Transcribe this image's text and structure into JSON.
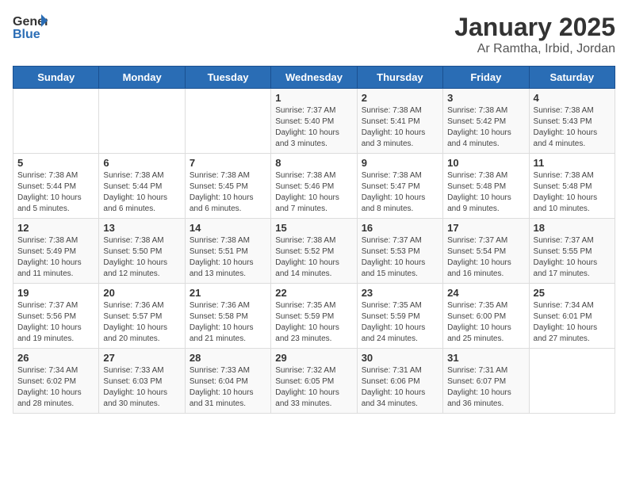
{
  "header": {
    "logo_general": "General",
    "logo_blue": "Blue",
    "month": "January 2025",
    "location": "Ar Ramtha, Irbid, Jordan"
  },
  "weekdays": [
    "Sunday",
    "Monday",
    "Tuesday",
    "Wednesday",
    "Thursday",
    "Friday",
    "Saturday"
  ],
  "weeks": [
    [
      {
        "day": "",
        "sunrise": "",
        "sunset": "",
        "daylight": ""
      },
      {
        "day": "",
        "sunrise": "",
        "sunset": "",
        "daylight": ""
      },
      {
        "day": "",
        "sunrise": "",
        "sunset": "",
        "daylight": ""
      },
      {
        "day": "1",
        "sunrise": "Sunrise: 7:37 AM",
        "sunset": "Sunset: 5:40 PM",
        "daylight": "Daylight: 10 hours and 3 minutes."
      },
      {
        "day": "2",
        "sunrise": "Sunrise: 7:38 AM",
        "sunset": "Sunset: 5:41 PM",
        "daylight": "Daylight: 10 hours and 3 minutes."
      },
      {
        "day": "3",
        "sunrise": "Sunrise: 7:38 AM",
        "sunset": "Sunset: 5:42 PM",
        "daylight": "Daylight: 10 hours and 4 minutes."
      },
      {
        "day": "4",
        "sunrise": "Sunrise: 7:38 AM",
        "sunset": "Sunset: 5:43 PM",
        "daylight": "Daylight: 10 hours and 4 minutes."
      }
    ],
    [
      {
        "day": "5",
        "sunrise": "Sunrise: 7:38 AM",
        "sunset": "Sunset: 5:44 PM",
        "daylight": "Daylight: 10 hours and 5 minutes."
      },
      {
        "day": "6",
        "sunrise": "Sunrise: 7:38 AM",
        "sunset": "Sunset: 5:44 PM",
        "daylight": "Daylight: 10 hours and 6 minutes."
      },
      {
        "day": "7",
        "sunrise": "Sunrise: 7:38 AM",
        "sunset": "Sunset: 5:45 PM",
        "daylight": "Daylight: 10 hours and 6 minutes."
      },
      {
        "day": "8",
        "sunrise": "Sunrise: 7:38 AM",
        "sunset": "Sunset: 5:46 PM",
        "daylight": "Daylight: 10 hours and 7 minutes."
      },
      {
        "day": "9",
        "sunrise": "Sunrise: 7:38 AM",
        "sunset": "Sunset: 5:47 PM",
        "daylight": "Daylight: 10 hours and 8 minutes."
      },
      {
        "day": "10",
        "sunrise": "Sunrise: 7:38 AM",
        "sunset": "Sunset: 5:48 PM",
        "daylight": "Daylight: 10 hours and 9 minutes."
      },
      {
        "day": "11",
        "sunrise": "Sunrise: 7:38 AM",
        "sunset": "Sunset: 5:48 PM",
        "daylight": "Daylight: 10 hours and 10 minutes."
      }
    ],
    [
      {
        "day": "12",
        "sunrise": "Sunrise: 7:38 AM",
        "sunset": "Sunset: 5:49 PM",
        "daylight": "Daylight: 10 hours and 11 minutes."
      },
      {
        "day": "13",
        "sunrise": "Sunrise: 7:38 AM",
        "sunset": "Sunset: 5:50 PM",
        "daylight": "Daylight: 10 hours and 12 minutes."
      },
      {
        "day": "14",
        "sunrise": "Sunrise: 7:38 AM",
        "sunset": "Sunset: 5:51 PM",
        "daylight": "Daylight: 10 hours and 13 minutes."
      },
      {
        "day": "15",
        "sunrise": "Sunrise: 7:38 AM",
        "sunset": "Sunset: 5:52 PM",
        "daylight": "Daylight: 10 hours and 14 minutes."
      },
      {
        "day": "16",
        "sunrise": "Sunrise: 7:37 AM",
        "sunset": "Sunset: 5:53 PM",
        "daylight": "Daylight: 10 hours and 15 minutes."
      },
      {
        "day": "17",
        "sunrise": "Sunrise: 7:37 AM",
        "sunset": "Sunset: 5:54 PM",
        "daylight": "Daylight: 10 hours and 16 minutes."
      },
      {
        "day": "18",
        "sunrise": "Sunrise: 7:37 AM",
        "sunset": "Sunset: 5:55 PM",
        "daylight": "Daylight: 10 hours and 17 minutes."
      }
    ],
    [
      {
        "day": "19",
        "sunrise": "Sunrise: 7:37 AM",
        "sunset": "Sunset: 5:56 PM",
        "daylight": "Daylight: 10 hours and 19 minutes."
      },
      {
        "day": "20",
        "sunrise": "Sunrise: 7:36 AM",
        "sunset": "Sunset: 5:57 PM",
        "daylight": "Daylight: 10 hours and 20 minutes."
      },
      {
        "day": "21",
        "sunrise": "Sunrise: 7:36 AM",
        "sunset": "Sunset: 5:58 PM",
        "daylight": "Daylight: 10 hours and 21 minutes."
      },
      {
        "day": "22",
        "sunrise": "Sunrise: 7:35 AM",
        "sunset": "Sunset: 5:59 PM",
        "daylight": "Daylight: 10 hours and 23 minutes."
      },
      {
        "day": "23",
        "sunrise": "Sunrise: 7:35 AM",
        "sunset": "Sunset: 5:59 PM",
        "daylight": "Daylight: 10 hours and 24 minutes."
      },
      {
        "day": "24",
        "sunrise": "Sunrise: 7:35 AM",
        "sunset": "Sunset: 6:00 PM",
        "daylight": "Daylight: 10 hours and 25 minutes."
      },
      {
        "day": "25",
        "sunrise": "Sunrise: 7:34 AM",
        "sunset": "Sunset: 6:01 PM",
        "daylight": "Daylight: 10 hours and 27 minutes."
      }
    ],
    [
      {
        "day": "26",
        "sunrise": "Sunrise: 7:34 AM",
        "sunset": "Sunset: 6:02 PM",
        "daylight": "Daylight: 10 hours and 28 minutes."
      },
      {
        "day": "27",
        "sunrise": "Sunrise: 7:33 AM",
        "sunset": "Sunset: 6:03 PM",
        "daylight": "Daylight: 10 hours and 30 minutes."
      },
      {
        "day": "28",
        "sunrise": "Sunrise: 7:33 AM",
        "sunset": "Sunset: 6:04 PM",
        "daylight": "Daylight: 10 hours and 31 minutes."
      },
      {
        "day": "29",
        "sunrise": "Sunrise: 7:32 AM",
        "sunset": "Sunset: 6:05 PM",
        "daylight": "Daylight: 10 hours and 33 minutes."
      },
      {
        "day": "30",
        "sunrise": "Sunrise: 7:31 AM",
        "sunset": "Sunset: 6:06 PM",
        "daylight": "Daylight: 10 hours and 34 minutes."
      },
      {
        "day": "31",
        "sunrise": "Sunrise: 7:31 AM",
        "sunset": "Sunset: 6:07 PM",
        "daylight": "Daylight: 10 hours and 36 minutes."
      },
      {
        "day": "",
        "sunrise": "",
        "sunset": "",
        "daylight": ""
      }
    ]
  ]
}
